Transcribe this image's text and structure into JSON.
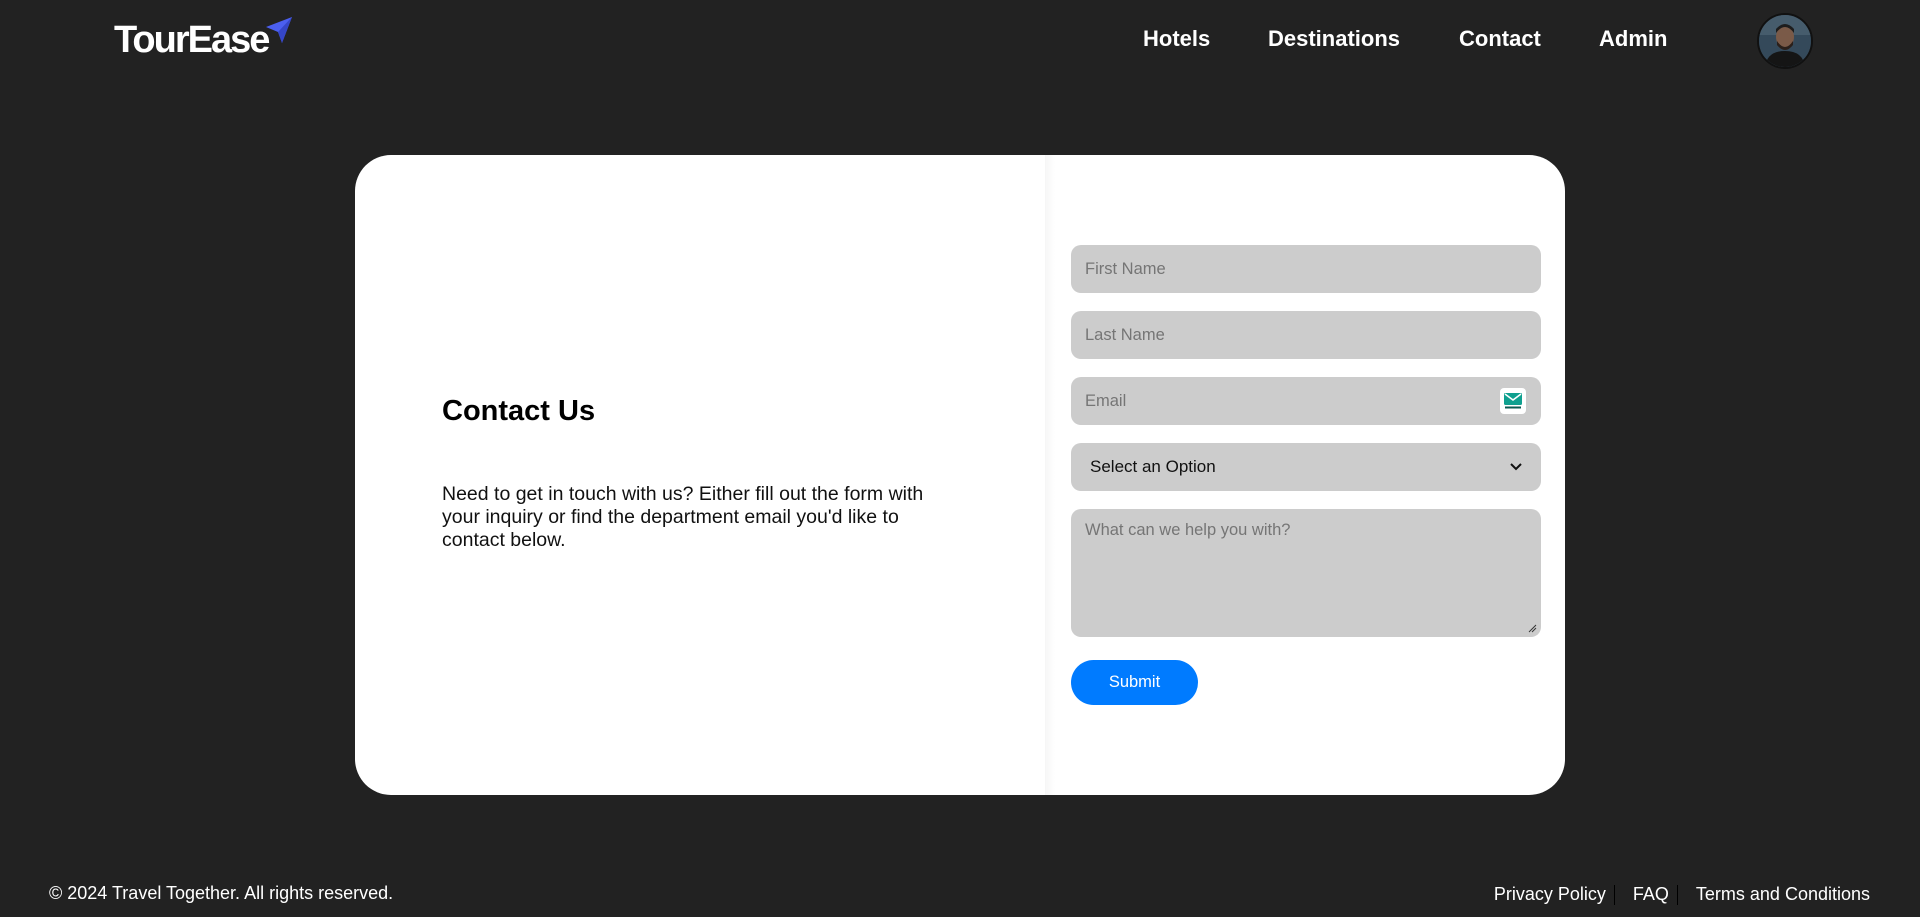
{
  "header": {
    "logo_text": "TourEase",
    "nav": [
      {
        "label": "Hotels"
      },
      {
        "label": "Destinations"
      },
      {
        "label": "Contact"
      },
      {
        "label": "Admin"
      }
    ]
  },
  "contact": {
    "title": "Contact Us",
    "description": "Need to get in touch with us? Either fill out the form with your inquiry or find the department email you'd like to contact below."
  },
  "form": {
    "first_name_placeholder": "First Name",
    "last_name_placeholder": "Last Name",
    "email_placeholder": "Email",
    "select_value": "Select an Option",
    "message_placeholder": "What can we help you with?",
    "submit_label": "Submit"
  },
  "footer": {
    "copyright": "© 2024 Travel Together. All rights reserved.",
    "links": [
      {
        "label": "Privacy Policy"
      },
      {
        "label": "FAQ"
      },
      {
        "label": "Terms and Conditions"
      }
    ]
  },
  "colors": {
    "background": "#222222",
    "card": "#ffffff",
    "input": "#cccccc",
    "accent": "#007bff",
    "logo_plane": "#4b5ff0"
  },
  "icons": {
    "logo_plane": "paper-plane-icon",
    "email_badge": "email-icon",
    "select_arrow": "chevron-down-icon",
    "avatar": "user-avatar"
  }
}
